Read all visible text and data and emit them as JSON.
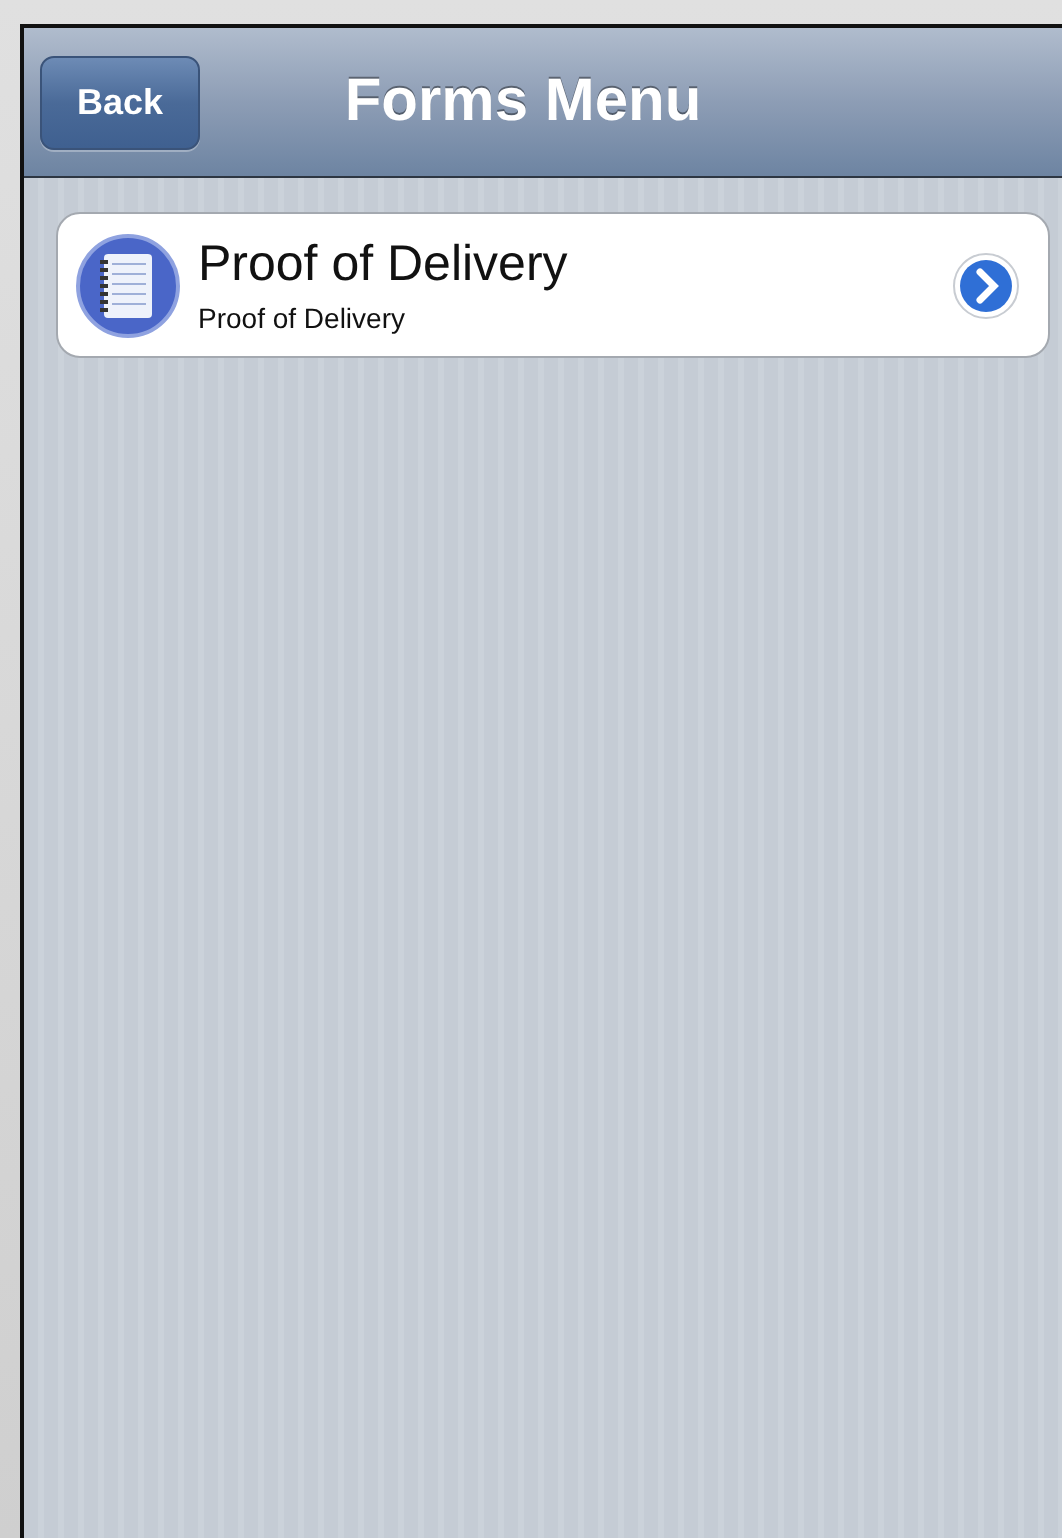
{
  "nav_bar": {
    "title": "Forms Menu",
    "back_button": "Back"
  },
  "forms": [
    {
      "title": "Proof of Delivery",
      "subtitle": "Proof of Delivery"
    }
  ]
}
